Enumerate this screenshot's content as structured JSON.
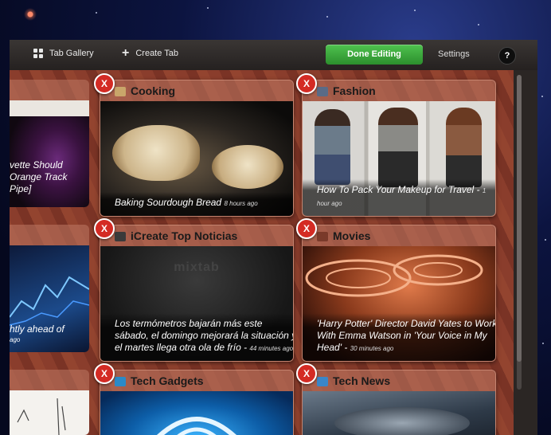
{
  "toolbar": {
    "tab_gallery_label": "Tab Gallery",
    "create_tab_label": "Create Tab",
    "done_editing_label": "Done Editing",
    "settings_label": "Settings",
    "help_label": "?",
    "close_badge_label": "X"
  },
  "tiles": [
    {
      "title": "Cooking",
      "caption": "Baking Sourdough Bread",
      "ago": "8 hours ago"
    },
    {
      "title": "Fashion",
      "caption": "How To Pack Your Makeup for Travel",
      "ago": "1 hour ago"
    },
    {
      "title": "iCreate Top Noticias",
      "caption": "Los termómetros bajarán más este sábado, el domingo mejorará la situación y el martes llega otra ola de frío",
      "ago": "44 minutes ago",
      "watermark": "mixtab"
    },
    {
      "title": "Movies",
      "caption": "'Harry Potter' Director David Yates to Work With Emma Watson in 'Your Voice in My Head'",
      "ago": "30 minutes ago"
    },
    {
      "title": "Tech Gadgets"
    },
    {
      "title": "Tech News"
    }
  ],
  "left_column": {
    "top_caption_l1": "vette Should",
    "top_caption_l2": "Orange Track",
    "top_caption_l3": "Pipe]",
    "mid_caption_l1": "htly ahead of",
    "mid_caption_l2": "ago"
  }
}
